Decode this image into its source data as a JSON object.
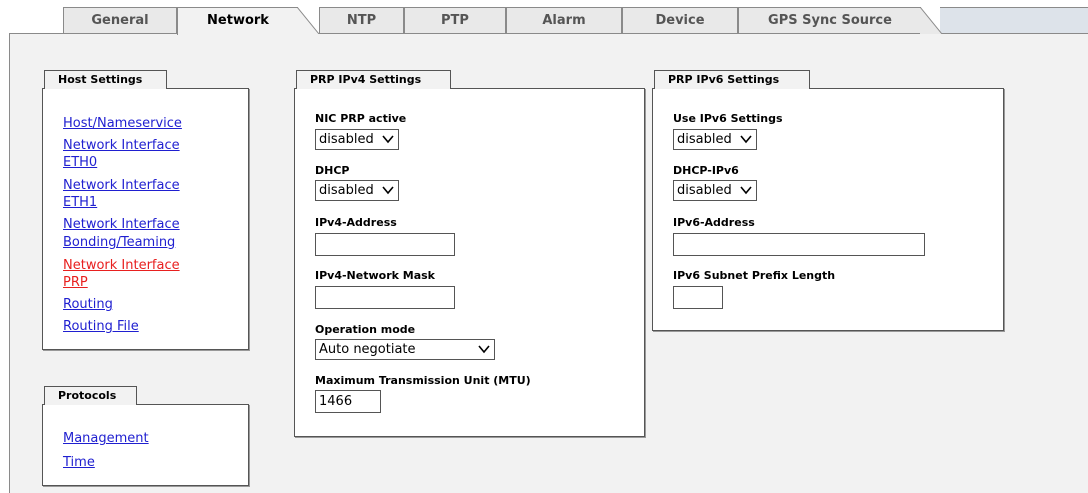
{
  "tabs": [
    {
      "label": "General"
    },
    {
      "label": "Network"
    },
    {
      "label": "NTP"
    },
    {
      "label": "PTP"
    },
    {
      "label": "Alarm"
    },
    {
      "label": "Device"
    },
    {
      "label": "GPS Sync Source"
    }
  ],
  "host_settings": {
    "title": "Host Settings",
    "links": {
      "host_nameservice": "Host/Nameservice",
      "eth0_line1": "Network Interface",
      "eth0_line2": "ETH0",
      "eth1_line1": "Network Interface",
      "eth1_line2": "ETH1",
      "bonding_line1": "Network Interface",
      "bonding_line2": "Bonding/Teaming",
      "prp_line1": "Network Interface",
      "prp_line2": "PRP",
      "routing": "Routing",
      "routing_file": "Routing File"
    }
  },
  "protocols": {
    "title": "Protocols",
    "links": {
      "management": "Management",
      "time": "Time"
    }
  },
  "prp_ipv4": {
    "title": "PRP IPv4 Settings",
    "nic_prp_active_label": "NIC PRP active",
    "nic_prp_active_value": "disabled",
    "dhcp_label": "DHCP",
    "dhcp_value": "disabled",
    "ipv4_address_label": "IPv4-Address",
    "ipv4_address_value": "",
    "netmask_label": "IPv4-Network Mask",
    "netmask_value": "",
    "operation_mode_label": "Operation mode",
    "operation_mode_value": "Auto negotiate",
    "mtu_label": "Maximum Transmission Unit (MTU)",
    "mtu_value": "1466"
  },
  "prp_ipv6": {
    "title": "PRP IPv6 Settings",
    "use_ipv6_label": "Use IPv6 Settings",
    "use_ipv6_value": "disabled",
    "dhcp_ipv6_label": "DHCP-IPv6",
    "dhcp_ipv6_value": "disabled",
    "ipv6_address_label": "IPv6-Address",
    "ipv6_address_value": "",
    "prefix_label": "IPv6 Subnet Prefix Length",
    "prefix_value": ""
  },
  "colors": {
    "link": "#1f1fd0",
    "active_link": "#e8201f",
    "panel_bg": "#f2f2f2",
    "tab_bg": "#e9e9e9"
  }
}
